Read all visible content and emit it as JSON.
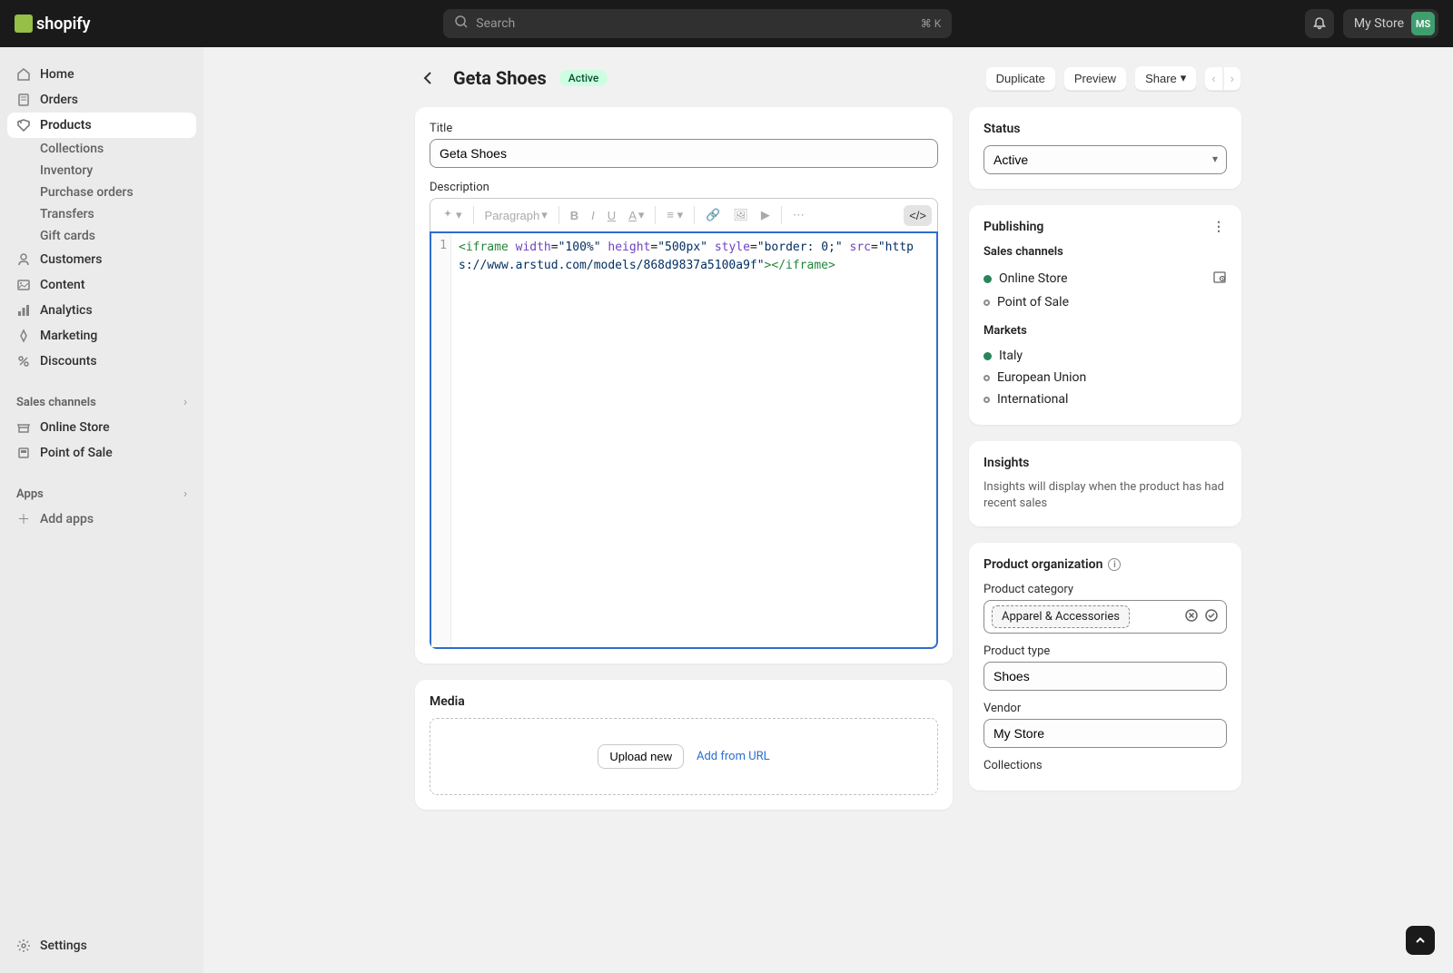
{
  "topbar": {
    "logo_text": "shopify",
    "search_placeholder": "Search",
    "search_kbd": "⌘ K",
    "store_name": "My Store",
    "avatar_initials": "MS"
  },
  "sidebar": {
    "items": [
      {
        "label": "Home",
        "icon": "home"
      },
      {
        "label": "Orders",
        "icon": "orders"
      },
      {
        "label": "Products",
        "icon": "products",
        "active": true
      },
      {
        "label": "Customers",
        "icon": "customers"
      },
      {
        "label": "Content",
        "icon": "content"
      },
      {
        "label": "Analytics",
        "icon": "analytics"
      },
      {
        "label": "Marketing",
        "icon": "marketing"
      },
      {
        "label": "Discounts",
        "icon": "discounts"
      }
    ],
    "products_sub": [
      {
        "label": "Collections"
      },
      {
        "label": "Inventory"
      },
      {
        "label": "Purchase orders"
      },
      {
        "label": "Transfers"
      },
      {
        "label": "Gift cards"
      }
    ],
    "section_sales": "Sales channels",
    "sales_items": [
      {
        "label": "Online Store"
      },
      {
        "label": "Point of Sale"
      }
    ],
    "section_apps": "Apps",
    "add_apps": "Add apps",
    "settings": "Settings"
  },
  "page": {
    "title": "Geta Shoes",
    "badge": "Active",
    "actions": {
      "duplicate": "Duplicate",
      "preview": "Preview",
      "share": "Share"
    }
  },
  "title_card": {
    "label": "Title",
    "value": "Geta Shoes",
    "desc_label": "Description",
    "paragraph_label": "Paragraph",
    "code_line_1": "1",
    "code_content": "<iframe width=\"100%\" height=\"500px\" style=\"border: 0;\" src=\"https://www.arstud.com/models/868d9837a5100a9f\"></iframe>"
  },
  "media": {
    "title": "Media",
    "upload": "Upload new",
    "add_url": "Add from URL"
  },
  "status": {
    "title": "Status",
    "value": "Active"
  },
  "publishing": {
    "title": "Publishing",
    "sales_label": "Sales channels",
    "channels": [
      {
        "label": "Online Store",
        "dot": "green",
        "action": true
      },
      {
        "label": "Point of Sale",
        "dot": "hollow"
      }
    ],
    "markets_label": "Markets",
    "markets": [
      {
        "label": "Italy",
        "dot": "green"
      },
      {
        "label": "European Union",
        "dot": "hollow"
      },
      {
        "label": "International",
        "dot": "hollow"
      }
    ]
  },
  "insights": {
    "title": "Insights",
    "text": "Insights will display when the product has had recent sales"
  },
  "org": {
    "title": "Product organization",
    "category_label": "Product category",
    "category_value": "Apparel & Accessories",
    "type_label": "Product type",
    "type_value": "Shoes",
    "vendor_label": "Vendor",
    "vendor_value": "My Store",
    "collections_label": "Collections"
  }
}
